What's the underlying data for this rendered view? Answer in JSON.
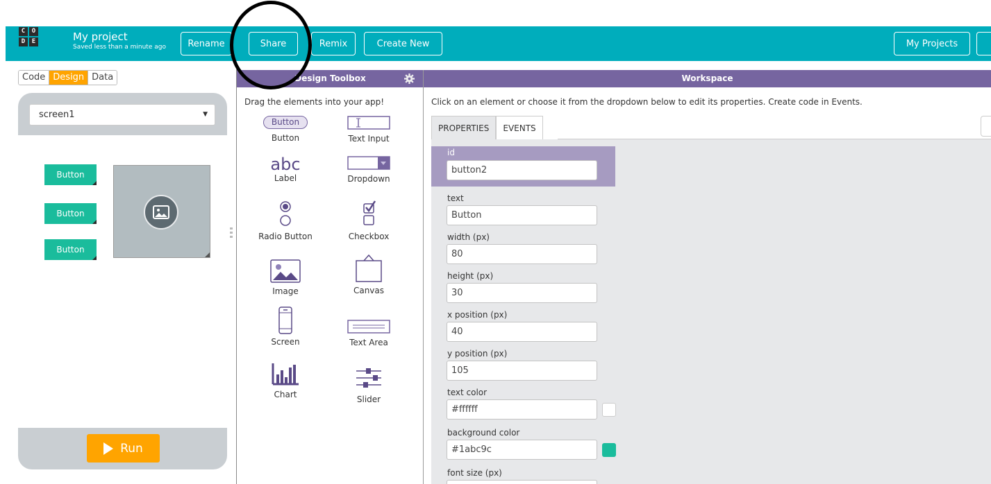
{
  "header": {
    "logo_letters": [
      "C",
      "O",
      "D",
      "E"
    ],
    "project_title": "My project",
    "save_status": "Saved less than a minute ago",
    "buttons": {
      "rename": "Rename",
      "share": "Share",
      "remix": "Remix",
      "create_new": "Create New",
      "my_projects": "My Projects"
    },
    "bg_color": "#00adbc"
  },
  "left_panel": {
    "mode_tabs": [
      "Code",
      "Design",
      "Data"
    ],
    "active_mode": "Design",
    "screen_select": "screen1",
    "app_buttons": [
      "Button",
      "Button",
      "Button"
    ],
    "run_label": "Run"
  },
  "toolbox": {
    "title": "Design Toolbox",
    "hint": "Drag the elements into your app!",
    "button_icon_text": "Button",
    "label_icon_text": "abc",
    "items": {
      "button": "Button",
      "text_input": "Text Input",
      "label": "Label",
      "dropdown": "Dropdown",
      "radio_button": "Radio Button",
      "checkbox": "Checkbox",
      "image": "Image",
      "canvas": "Canvas",
      "screen": "Screen",
      "text_area": "Text Area",
      "chart": "Chart",
      "slider": "Slider"
    }
  },
  "workspace": {
    "title": "Workspace",
    "hint": "Click on an element or choose it from the dropdown below to edit its properties. Create code in Events.",
    "tabs": [
      "PROPERTIES",
      "EVENTS"
    ],
    "active_tab": "PROPERTIES",
    "properties": {
      "id_label": "id",
      "id_value": "button2",
      "text_label": "text",
      "text_value": "Button",
      "width_label": "width (px)",
      "width_value": "80",
      "height_label": "height (px)",
      "height_value": "30",
      "x_label": "x position (px)",
      "x_value": "40",
      "y_label": "y position (px)",
      "y_value": "105",
      "text_color_label": "text color",
      "text_color_value": "#ffffff",
      "bg_color_label": "background color",
      "bg_color_value": "#1abc9c",
      "font_size_label": "font size (px)"
    }
  },
  "colors": {
    "accent_purple": "#7665a0",
    "run_orange": "#ffa400",
    "button_teal": "#1abc9c"
  }
}
